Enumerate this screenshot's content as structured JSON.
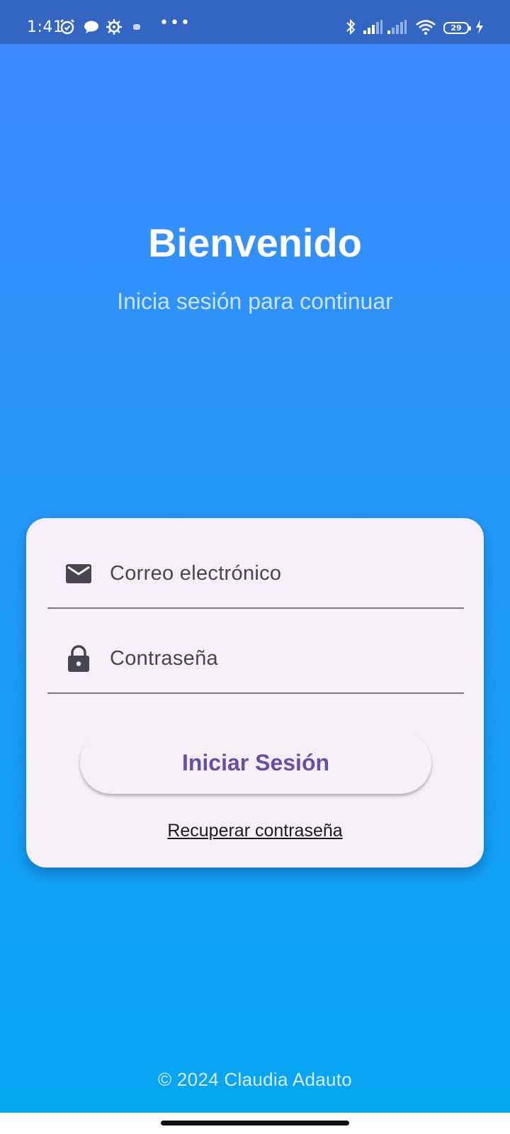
{
  "status_bar": {
    "time": "1:41",
    "battery_level": "29",
    "dots": "•••",
    "icons": [
      "alarm-icon",
      "chat-icon",
      "settings-gear-icon",
      "notification-icon",
      "bluetooth-icon",
      "cell-signal-icon",
      "cell-signal-icon",
      "wifi-icon",
      "battery-icon",
      "charging-icon"
    ]
  },
  "header": {
    "title": "Bienvenido",
    "subtitle": "Inicia sesión para continuar"
  },
  "login_form": {
    "email_label": "Correo electrónico",
    "email_icon": "mail-icon",
    "password_label": "Contraseña",
    "password_icon": "lock-icon",
    "submit_label": "Iniciar Sesión",
    "recover_label": "Recuperar contraseña"
  },
  "footer": {
    "copyright": "© 2024 Claudia Adauto"
  },
  "colors": {
    "gradient_top": "#3f89fe",
    "gradient_bottom": "#06a6f1",
    "status_bar": "#3266c0",
    "card_background": "#f5f0f8",
    "button_text": "#6a4ea5"
  }
}
